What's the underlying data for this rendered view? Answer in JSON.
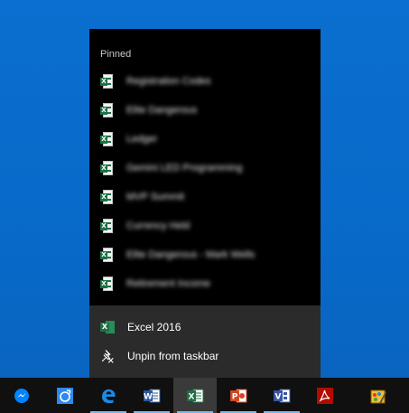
{
  "jumplist": {
    "section_label": "Pinned",
    "pinned": [
      {
        "label": "Registration Codes"
      },
      {
        "label": "Elite Dangerous"
      },
      {
        "label": "Ledger"
      },
      {
        "label": "Gemini LED Programming"
      },
      {
        "label": "MVP Summit"
      },
      {
        "label": "Currency Held"
      },
      {
        "label": "Elite Dangerous - Mark Wells"
      },
      {
        "label": "Retirement Income"
      }
    ],
    "actions": {
      "app_label": "Excel 2016",
      "unpin_label": "Unpin from taskbar"
    }
  },
  "taskbar": {
    "apps": [
      {
        "name": "messenger",
        "icon": "messenger-icon"
      },
      {
        "name": "cortana",
        "icon": "cortana-icon"
      },
      {
        "name": "edge",
        "icon": "edge-icon"
      },
      {
        "name": "word",
        "icon": "word-icon"
      },
      {
        "name": "excel",
        "icon": "excel-icon",
        "active": true
      },
      {
        "name": "powerpoint",
        "icon": "powerpoint-icon"
      },
      {
        "name": "visio",
        "icon": "visio-icon"
      },
      {
        "name": "acrobat",
        "icon": "acrobat-icon"
      },
      {
        "name": "paint",
        "icon": "paint-icon"
      }
    ]
  },
  "colors": {
    "desktop": "#0a6fd0",
    "jumplist_bg": "#000000",
    "actions_bg": "#2b2b2b",
    "taskbar_bg": "#101010",
    "excel_green": "#1e7145",
    "running_indicator": "#76b9ed"
  }
}
